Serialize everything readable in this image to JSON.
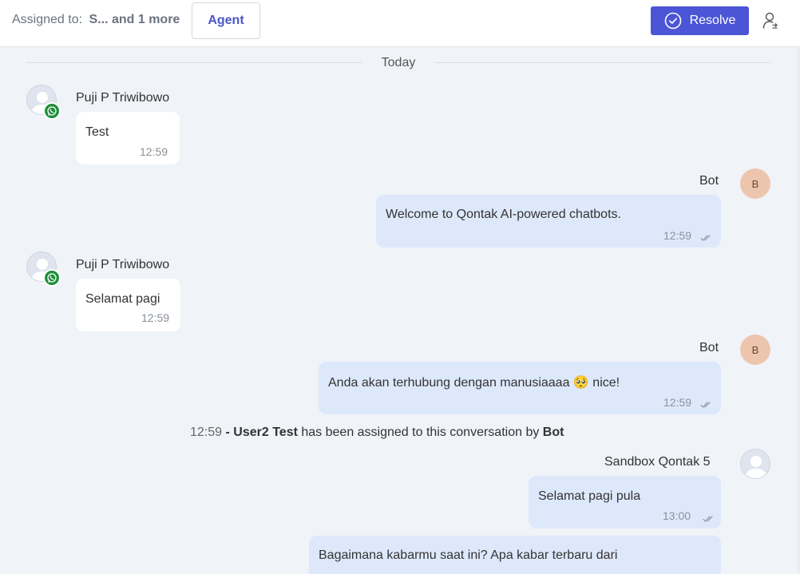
{
  "header": {
    "assigned_label": "Assigned to:",
    "assigned_value": "S... and 1 more",
    "agent_button": "Agent",
    "resolve_button": "Resolve"
  },
  "chat": {
    "day_label": "Today",
    "messages": [
      {
        "sender": "Puji P Triwibowo",
        "text": "Test",
        "time": "12:59",
        "direction": "incoming",
        "channel": "whatsapp"
      },
      {
        "sender": "Bot",
        "avatar_letter": "B",
        "text": "Welcome to Qontak AI-powered chatbots.",
        "time": "12:59",
        "direction": "outgoing"
      },
      {
        "sender": "Puji P Triwibowo",
        "text": "Selamat pagi",
        "time": "12:59",
        "direction": "incoming",
        "channel": "whatsapp"
      },
      {
        "sender": "Bot",
        "avatar_letter": "B",
        "text_before": "Anda akan terhubung dengan manusiaaaa",
        "emoji": "🥺",
        "text_after": "nice!",
        "time": "12:59",
        "direction": "outgoing"
      },
      {
        "sender": "Sandbox Qontak 5",
        "text": "Selamat pagi pula",
        "time": "13:00",
        "direction": "outgoing"
      },
      {
        "text": "Bagaimana kabarmu saat ini? Apa kabar terbaru dari",
        "direction": "outgoing"
      }
    ],
    "system_event": {
      "time": "12:59",
      "separator": "-",
      "user": "User2 Test",
      "text": "has been assigned to this conversation by",
      "actor": "Bot"
    }
  },
  "colors": {
    "accent": "#4b55d6",
    "agent_text": "#4a56c9",
    "chat_background": "#f0f3f8",
    "outgoing_bubble": "#dde9fb",
    "incoming_bubble": "#ffffff",
    "bot_avatar": "#edc5ad",
    "whatsapp_badge": "#1f8f3a"
  },
  "icons": [
    "check-circle-icon",
    "user-switch-icon",
    "whatsapp-icon",
    "double-check-icon",
    "user-avatar-icon"
  ]
}
